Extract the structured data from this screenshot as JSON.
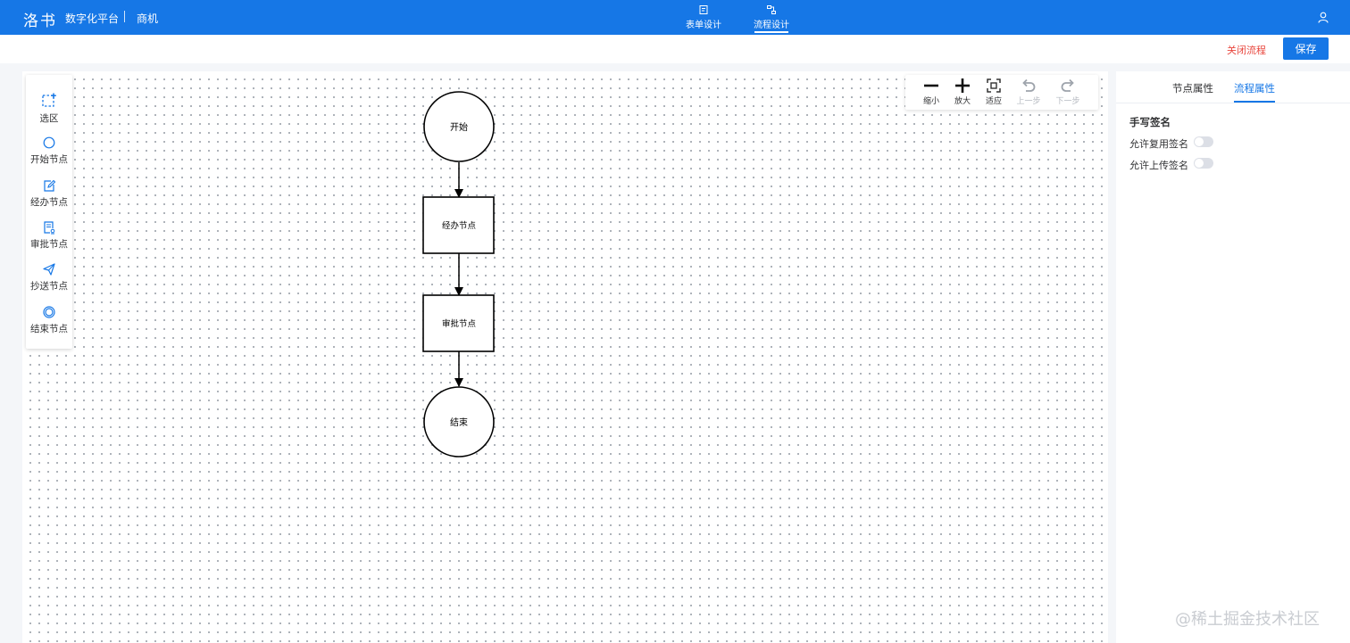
{
  "header": {
    "brand": "洛书",
    "platform": "数字化平台",
    "module": "商机",
    "tabs": [
      {
        "label": "表单设计",
        "active": false
      },
      {
        "label": "流程设计",
        "active": true
      }
    ]
  },
  "actions": {
    "close_label": "关闭流程",
    "save_label": "保存"
  },
  "palette": [
    {
      "label": "选区",
      "icon": "selection-icon"
    },
    {
      "label": "开始节点",
      "icon": "circle-icon"
    },
    {
      "label": "经办节点",
      "icon": "edit-icon"
    },
    {
      "label": "审批节点",
      "icon": "approve-icon"
    },
    {
      "label": "抄送节点",
      "icon": "send-icon"
    },
    {
      "label": "结束节点",
      "icon": "end-circle-icon"
    }
  ],
  "zoom_toolbar": [
    {
      "label": "缩小",
      "icon": "minus-icon",
      "enabled": true
    },
    {
      "label": "放大",
      "icon": "plus-icon",
      "enabled": true
    },
    {
      "label": "适应",
      "icon": "fit-icon",
      "enabled": true
    },
    {
      "label": "上一步",
      "icon": "undo-icon",
      "enabled": false
    },
    {
      "label": "下一步",
      "icon": "redo-icon",
      "enabled": false
    }
  ],
  "flow": {
    "nodes": [
      {
        "label": "开始",
        "shape": "circle"
      },
      {
        "label": "经办节点",
        "shape": "rect"
      },
      {
        "label": "审批节点",
        "shape": "rect"
      },
      {
        "label": "结束",
        "shape": "circle"
      }
    ]
  },
  "panel": {
    "tabs": [
      {
        "label": "节点属性",
        "active": false
      },
      {
        "label": "流程属性",
        "active": true
      }
    ],
    "section_title": "手写签名",
    "options": [
      {
        "label": "允许复用签名",
        "enabled": false
      },
      {
        "label": "允许上传签名",
        "enabled": false
      }
    ]
  },
  "colors": {
    "primary": "#1677e6",
    "danger": "#e8453c"
  },
  "watermark": "@稀土掘金技术社区"
}
